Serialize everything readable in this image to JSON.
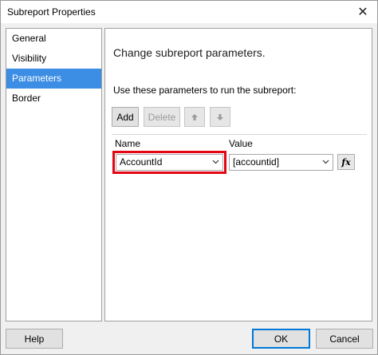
{
  "window": {
    "title": "Subreport Properties",
    "close_glyph": "✕"
  },
  "nav": {
    "items": [
      {
        "label": "General",
        "selected": false
      },
      {
        "label": "Visibility",
        "selected": false
      },
      {
        "label": "Parameters",
        "selected": true
      },
      {
        "label": "Border",
        "selected": false
      }
    ]
  },
  "content": {
    "heading": "Change subreport parameters.",
    "instruction": "Use these parameters to run the subreport:",
    "toolbar": {
      "add_label": "Add",
      "delete_label": "Delete",
      "move_up_icon": "arrow-up-icon",
      "move_down_icon": "arrow-down-icon"
    },
    "grid": {
      "columns": [
        "Name",
        "Value"
      ],
      "rows": [
        {
          "name": "AccountId",
          "value": "[accountid]",
          "expression_label": "fx"
        }
      ]
    }
  },
  "footer": {
    "help_label": "Help",
    "ok_label": "OK",
    "cancel_label": "Cancel"
  },
  "colors": {
    "selection": "#3c8de4",
    "highlight": "#e30613",
    "default_button_border": "#0078d7"
  }
}
